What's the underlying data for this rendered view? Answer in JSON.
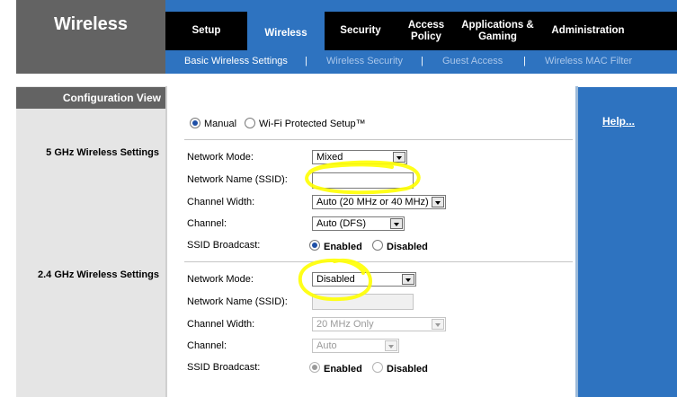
{
  "header": {
    "page_title": "Wireless"
  },
  "nav": {
    "tabs": [
      {
        "label": "Setup"
      },
      {
        "label": "Wireless"
      },
      {
        "label": "Security"
      },
      {
        "label_line1": "Access",
        "label_line2": "Policy"
      },
      {
        "label_line1": "Applications &",
        "label_line2": "Gaming"
      },
      {
        "label": "Administration"
      }
    ],
    "active_tab": "Wireless"
  },
  "subnav": {
    "items": [
      "Basic Wireless Settings",
      "Wireless Security",
      "Guest Access",
      "Wireless MAC Filter"
    ],
    "separator": "|",
    "active": "Basic Wireless Settings"
  },
  "sidebar": {
    "config_view": "Configuration View",
    "section_5ghz": "5 GHz Wireless Settings",
    "section_24ghz": "2.4 GHz Wireless Settings"
  },
  "help": {
    "label": "Help..."
  },
  "setup_mode": {
    "manual_label": "Manual",
    "wps_label": "Wi-Fi Protected Setup™",
    "selected": "Manual"
  },
  "ghz5": {
    "network_mode_label": "Network Mode:",
    "network_mode_value": "Mixed",
    "ssid_label": "Network Name (SSID):",
    "ssid_value": "",
    "channel_width_label": "Channel Width:",
    "channel_width_value": "Auto (20 MHz or 40 MHz)",
    "channel_label": "Channel:",
    "channel_value": "Auto (DFS)",
    "ssid_broadcast_label": "SSID Broadcast:",
    "enabled_label": "Enabled",
    "disabled_label": "Disabled",
    "ssid_broadcast": "Enabled"
  },
  "ghz24": {
    "network_mode_label": "Network Mode:",
    "network_mode_value": "Disabled",
    "ssid_label": "Network Name (SSID):",
    "ssid_value": "",
    "channel_width_label": "Channel Width:",
    "channel_width_value": "20 MHz Only",
    "channel_label": "Channel:",
    "channel_value": "Auto",
    "ssid_broadcast_label": "SSID Broadcast:",
    "enabled_label": "Enabled",
    "disabled_label": "Disabled",
    "ssid_broadcast": "Enabled"
  },
  "colors": {
    "brand_blue": "#2e73c0",
    "nav_black": "#000000",
    "header_gray": "#636363",
    "highlight_yellow": "#ffff00"
  }
}
